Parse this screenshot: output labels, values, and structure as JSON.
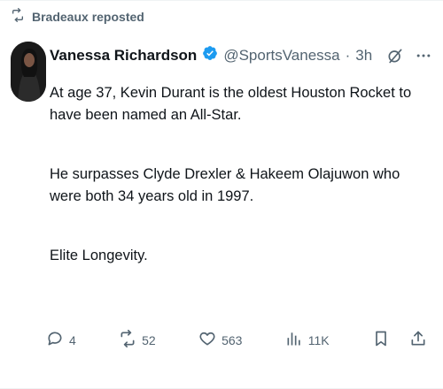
{
  "repost": {
    "label": "Bradeaux reposted",
    "icon": "repost-icon"
  },
  "author": {
    "name": "Vanessa Richardson",
    "handle": "@SportsVanessa",
    "separator": "·",
    "time": "3h",
    "verified": true,
    "verified_color": "#1d9bf0"
  },
  "post": {
    "paragraphs": [
      "At age 37, Kevin Durant is the oldest Houston Rocket to have been named an All-Star.",
      "He surpasses Clyde Drexler & Hakeem Olajuwon who were both 34 years old in 1997.",
      "Elite Longevity."
    ]
  },
  "actions": {
    "replies": "4",
    "reposts": "52",
    "likes": "563",
    "views": "11K"
  },
  "colors": {
    "text": "#0f1419",
    "muted": "#536471",
    "verified": "#1d9bf0"
  }
}
